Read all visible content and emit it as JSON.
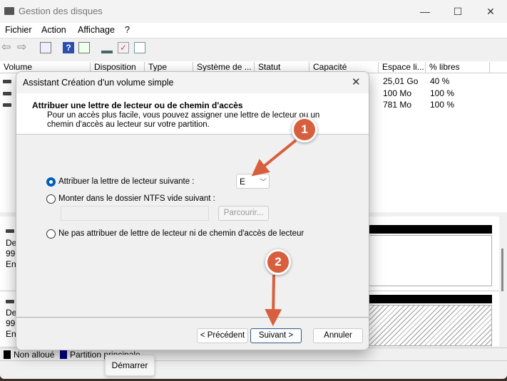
{
  "window": {
    "title": "Gestion des disques"
  },
  "menu": [
    "Fichier",
    "Action",
    "Affichage",
    "?"
  ],
  "columns": [
    "Volume",
    "Disposition",
    "Type",
    "Système de ...",
    "Statut",
    "Capacité",
    "Espace li...",
    "% libres"
  ],
  "rows": [
    {
      "free": "25,01 Go",
      "pct": "40 %"
    },
    {
      "free": "100 Mo",
      "pct": "100 %"
    },
    {
      "free": "781 Mo",
      "pct": "100 %"
    }
  ],
  "disks": [
    {
      "l1": "De",
      "l2": "99,",
      "l3": "En"
    },
    {
      "l1": "De",
      "l2": "99,",
      "l3": "En"
    }
  ],
  "legend": {
    "unallocated": "Non alloué",
    "primary": "Partition principale",
    "unallocated_color": "#000000",
    "primary_color": "#000080"
  },
  "tooltip": "Démarrer",
  "dialog": {
    "title": "Assistant Création d'un volume simple",
    "heading": "Attribuer une lettre de lecteur ou de chemin d'accès",
    "description_1": "Pour un accès plus facile, vous pouvez assigner une lettre de lecteur ou un",
    "description_2": "chemin d'accès au lecteur sur votre partition.",
    "option_assign": "Attribuer la lettre de lecteur suivante :",
    "drive_letter": "E",
    "option_mount": "Monter dans le dossier NTFS vide suivant :",
    "folder_path": "",
    "browse": "Parcourir...",
    "option_none": "Ne pas attribuer de lettre de lecteur ni de chemin d'accès de lecteur",
    "selected_option": "assign",
    "back": "< Précédent",
    "next": "Suivant >",
    "cancel": "Annuler"
  },
  "annotations": [
    {
      "label": "1",
      "color": "#d75f3d"
    },
    {
      "label": "2",
      "color": "#d75f3d"
    }
  ]
}
